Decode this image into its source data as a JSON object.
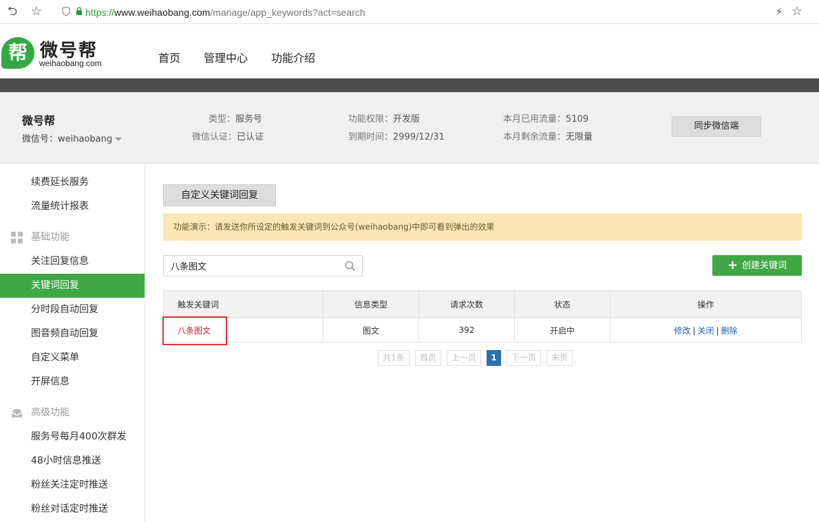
{
  "browser": {
    "url_scheme": "https://",
    "url_host": "www.weihaobang.com",
    "url_path": "/manage/app_keywords?act=search",
    "icons": [
      "back-icon",
      "star-icon",
      "shield-icon",
      "lock-icon",
      "lightning-icon",
      "star-icon"
    ]
  },
  "site": {
    "logo_char": "帮",
    "logo_name": "微号帮",
    "logo_domain": "weihaobang.com",
    "nav": [
      "首页",
      "管理中心",
      "功能介绍"
    ]
  },
  "account": {
    "name": "微号帮",
    "wx_label": "微信号：",
    "wx_id": "weihaobang",
    "type_label": "类型：",
    "type_value": "服务号",
    "auth_label": "微信认证：",
    "auth_value": "已认证",
    "perm_label": "功能权限：",
    "perm_value": "开发版",
    "expire_label": "到期时间：",
    "expire_value": "2999/12/31",
    "used_label": "本月已用流量：",
    "used_value": "5109",
    "remain_label": "本月剩余流量：",
    "remain_value": "无限量",
    "sync_button": "同步微信端"
  },
  "sidebar": {
    "items_top": [
      "续费延长服务",
      "流量统计报表"
    ],
    "group_basic": "基础功能",
    "items_basic": [
      "关注回复信息",
      "关键词回复",
      "分时段自动回复",
      "图音频自动回复",
      "自定义菜单",
      "开屏信息"
    ],
    "group_advanced": "高级功能",
    "items_advanced": [
      "服务号每月400次群发",
      "48小时信息推送",
      "粉丝关注定时推送",
      "粉丝对话定时推送"
    ],
    "active": "关键词回复"
  },
  "main": {
    "tab": "自定义关键词回复",
    "notice": "功能演示：请发送你所设定的触发关键词到公众号(weihaobang)中即可看到弹出的效果",
    "search_value": "八条图文",
    "create_button": "创建关键词",
    "table": {
      "headers": [
        "触发关键词",
        "信息类型",
        "请求次数",
        "状态",
        "操作"
      ],
      "rows": [
        {
          "keyword": "八条图文",
          "type": "图文",
          "count": "392",
          "status": "开启中",
          "ops": [
            "修改",
            "关闭",
            "删除"
          ]
        }
      ]
    },
    "pager": {
      "total": "共1条",
      "first": "首页",
      "prev": "上一页",
      "current": "1",
      "next": "下一页",
      "last": "末页"
    }
  },
  "colors": {
    "brand_green": "#3fa845",
    "notice_bg": "#fbe7b5",
    "link_blue": "#1f5fa8",
    "keyword_red": "#c0272d",
    "highlight": "#e03030"
  }
}
